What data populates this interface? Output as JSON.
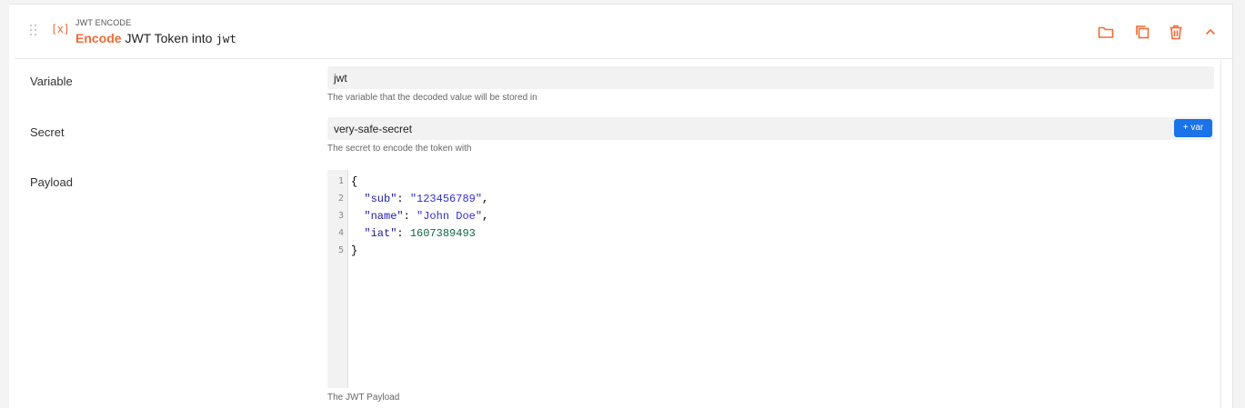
{
  "header": {
    "type_icon": "[x]",
    "subtitle": "JWT ENCODE",
    "title_keyword": "Encode",
    "title_text": " JWT Token into ",
    "title_code": "jwt",
    "actions": [
      "folder-icon",
      "copy-icon",
      "trash-icon",
      "chevron-up-icon"
    ]
  },
  "fields": {
    "variable": {
      "label": "Variable",
      "value": "jwt",
      "help": "The variable that the decoded value will be stored in"
    },
    "secret": {
      "label": "Secret",
      "value": "very-safe-secret",
      "help": "The secret to encode the token with",
      "var_button": "+ var"
    },
    "payload": {
      "label": "Payload",
      "help": "The JWT Payload",
      "line_numbers": [
        "1",
        "2",
        "3",
        "4",
        "5"
      ],
      "lines": [
        {
          "parts": [
            {
              "t": "{",
              "c": "p"
            }
          ]
        },
        {
          "parts": [
            {
              "t": "  ",
              "c": "p"
            },
            {
              "t": "\"sub\"",
              "c": "k"
            },
            {
              "t": ": ",
              "c": "p"
            },
            {
              "t": "\"123456789\"",
              "c": "s"
            },
            {
              "t": ",",
              "c": "p"
            }
          ]
        },
        {
          "parts": [
            {
              "t": "  ",
              "c": "p"
            },
            {
              "t": "\"name\"",
              "c": "k"
            },
            {
              "t": ": ",
              "c": "p"
            },
            {
              "t": "\"John Doe\"",
              "c": "s"
            },
            {
              "t": ",",
              "c": "p"
            }
          ]
        },
        {
          "parts": [
            {
              "t": "  ",
              "c": "p"
            },
            {
              "t": "\"iat\"",
              "c": "k"
            },
            {
              "t": ": ",
              "c": "p"
            },
            {
              "t": "1607389493",
              "c": "n"
            }
          ]
        },
        {
          "parts": [
            {
              "t": "}",
              "c": "p"
            }
          ]
        }
      ]
    }
  },
  "colors": {
    "accent": "#f26b35",
    "button": "#1a73e8"
  }
}
